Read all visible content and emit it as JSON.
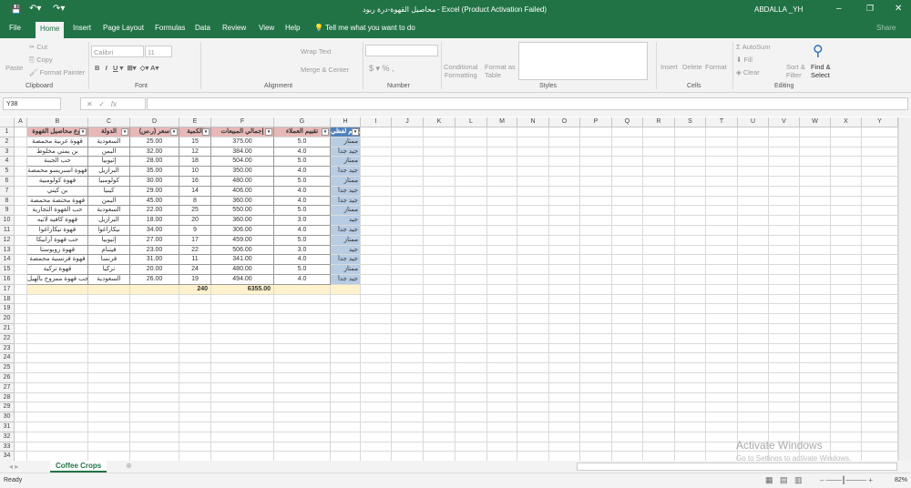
{
  "titlebar": {
    "doc": "محاصيل القهوة-درة ربود",
    "app": " -  Excel (Product Activation Failed)",
    "user": "ABDALLA _YH",
    "share": "Share"
  },
  "tabs": [
    "File",
    "Home",
    "Insert",
    "Page Layout",
    "Formulas",
    "Data",
    "Review",
    "View",
    "Help"
  ],
  "tell_me": "Tell me what you want to do",
  "ribbon": {
    "paste": "Paste",
    "cut": "Cut",
    "copy": "Copy",
    "format_painter": "Format Painter",
    "font": "Calibri",
    "size": "11",
    "wrap": "Wrap Text",
    "merge": "Merge & Center",
    "cond1": "Conditional",
    "cond2": "Formatting",
    "fmt1": "Format as",
    "fmt2": "Table",
    "insert": "Insert",
    "delete": "Delete",
    "format": "Format",
    "autosum": "AutoSum",
    "fill": "Fill",
    "clear": "Clear",
    "sort1": "Sort &",
    "sort2": "Filter",
    "find1": "Find &",
    "find2": "Select",
    "groups": {
      "clipboard": "Clipboard",
      "font": "Font",
      "alignment": "Alignment",
      "number": "Number",
      "styles": "Styles",
      "cells": "Cells",
      "editing": "Editing"
    }
  },
  "formula_bar": {
    "name_box": "Y38",
    "value": ""
  },
  "columns": [
    "A",
    "B",
    "C",
    "D",
    "E",
    "F",
    "G",
    "H",
    "I",
    "J",
    "K",
    "L",
    "M",
    "N",
    "O",
    "P",
    "Q",
    "R",
    "S",
    "T",
    "U",
    "V",
    "W",
    "X",
    "Y"
  ],
  "table": {
    "headers": [
      "نوع محاصيل القهوة",
      "الدولة",
      "سعر (ر.س)",
      "الكمية",
      "إجمالي المبيعات",
      "تقييم العملاء",
      "تقييم لفظي"
    ],
    "rows": [
      [
        "قهوة عربية محمصة",
        "السعودية",
        "25.00",
        "15",
        "375.00",
        "5.0",
        "ممتاز"
      ],
      [
        "بن يمني مخلوط",
        "اليمن",
        "32.00",
        "12",
        "384.00",
        "4.0",
        "جيد جداً"
      ],
      [
        "حب الجبنة",
        "إثيوبيا",
        "28.00",
        "18",
        "504.00",
        "5.0",
        "ممتاز"
      ],
      [
        "قهوة اسبريسو محمصة",
        "البرازيل",
        "35.00",
        "10",
        "350.00",
        "4.0",
        "جيد جداً"
      ],
      [
        "قهوة كولومبية",
        "كولومبيا",
        "30.00",
        "16",
        "480.00",
        "5.0",
        "ممتاز"
      ],
      [
        "بن كيني",
        "كينيا",
        "29.00",
        "14",
        "406.00",
        "4.0",
        "جيد جداً"
      ],
      [
        "قهوة مختصة محمصة",
        "اليمن",
        "45.00",
        "8",
        "360.00",
        "4.0",
        "جيد جداً"
      ],
      [
        "حب القهوة التجارية",
        "السعودية",
        "22.00",
        "25",
        "550.00",
        "5.0",
        "ممتاز"
      ],
      [
        "قهوة كافيه لاتيه",
        "البرازيل",
        "18.00",
        "20",
        "360.00",
        "3.0",
        "جيد"
      ],
      [
        "قهوة نيكاراغوا",
        "نيكاراغوا",
        "34.00",
        "9",
        "306.00",
        "4.0",
        "جيد جداً"
      ],
      [
        "حب قهوة أرابيكا",
        "إثيوبيا",
        "27.00",
        "17",
        "459.00",
        "5.0",
        "ممتاز"
      ],
      [
        "قهوة روبوستا",
        "فيتنام",
        "23.00",
        "22",
        "506.00",
        "3.0",
        "جيد"
      ],
      [
        "قهوة فرنسية محمصة",
        "فرنسا",
        "31.00",
        "11",
        "341.00",
        "4.0",
        "جيد جداً"
      ],
      [
        "قهوة تركية",
        "تركيا",
        "20.00",
        "24",
        "480.00",
        "5.0",
        "ممتاز"
      ],
      [
        "حب قهوة ممزوج بالهيل",
        "السعودية",
        "26.00",
        "19",
        "494.00",
        "4.0",
        "جيد جداً"
      ]
    ],
    "totals": {
      "quantity": "240",
      "sales": "6355.00"
    }
  },
  "sheet_tab": "Coffee Crops",
  "status": {
    "ready": "Ready",
    "zoom": "82%"
  },
  "watermark": {
    "title": "Activate Windows",
    "sub": "Go to Settings to activate Windows."
  },
  "colors": {
    "green": "#217346",
    "header_fill": "#e6b8b7",
    "blue_fill": "#b8cce4",
    "total_fill": "#fff2cc"
  }
}
